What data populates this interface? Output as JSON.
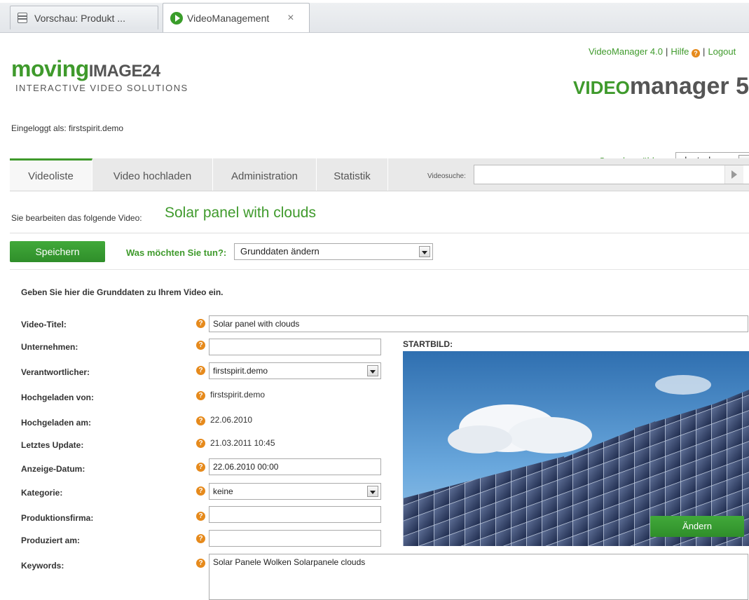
{
  "browser": {
    "tabs": [
      {
        "label": "Vorschau: Produkt ..."
      },
      {
        "label": "VideoManagement",
        "close": "×"
      }
    ]
  },
  "header": {
    "logo_moving": "moving",
    "logo_image": "IMAGE24",
    "logo_tagline": "INTERACTIVE VIDEO SOLUTIONS",
    "link_vm4": "VideoManager 4.0",
    "link_help": "Hilfe",
    "link_logout": "Logout",
    "product_video": "VIDEO",
    "product_manager": "manager 5",
    "logged_in": "Eingeloggt als: firstspirit.demo",
    "lang_label": "Sprache wählen",
    "lang_value": "deutsch"
  },
  "nav": {
    "tabs": [
      "Videoliste",
      "Video hochladen",
      "Administration",
      "Statistik"
    ],
    "search_label": "Videosuche:"
  },
  "edit": {
    "prefix": "Sie bearbeiten das folgende Video:",
    "title": "Solar panel with clouds",
    "save": "Speichern",
    "action_label": "Was möchten Sie tun?:",
    "action_value": "Grunddaten ändern",
    "intro": "Geben Sie hier die Grunddaten zu Ihrem Video ein."
  },
  "form": {
    "labels": {
      "title": "Video-Titel:",
      "company": "Unternehmen:",
      "responsible": "Verantwortlicher:",
      "uploaded_by": "Hochgeladen von:",
      "uploaded_on": "Hochgeladen am:",
      "last_update": "Letztes Update:",
      "display_date": "Anzeige-Datum:",
      "category": "Kategorie:",
      "production_company": "Produktionsfirma:",
      "produced_on": "Produziert am:",
      "keywords": "Keywords:"
    },
    "values": {
      "title": "Solar panel with clouds",
      "company": "",
      "responsible": "firstspirit.demo",
      "uploaded_by": "firstspirit.demo",
      "uploaded_on": "22.06.2010",
      "last_update": "21.03.2011 10:45",
      "display_date": "22.06.2010 00:00",
      "category": "keine",
      "production_company": "",
      "produced_on": "",
      "keywords": "Solar Panele Wolken Solarpanele clouds"
    }
  },
  "startbild": {
    "label": "STARTBILD:",
    "change": "Ändern"
  },
  "icons": {
    "help": "?"
  },
  "colors": {
    "accent_green": "#3f9a2c",
    "help_orange": "#e68a1c"
  }
}
